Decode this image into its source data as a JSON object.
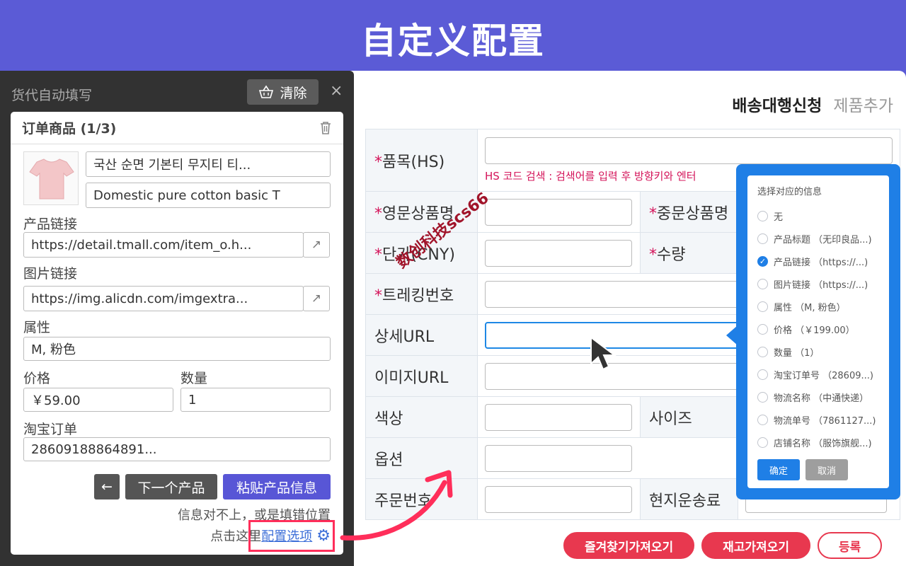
{
  "banner": {
    "title": "自定义配置"
  },
  "page": {
    "tabs": [
      {
        "label": "배송대행신청",
        "active": true
      },
      {
        "label": "제품추가",
        "active": false
      }
    ],
    "fields": {
      "hs_label": "품목(HS)",
      "hs_hint": "HS 코드 검색 : 검색어를 입력 후 방향키와 엔터",
      "eng_name": "영문상품명",
      "cn_name": "중문상품명",
      "price": "단가(CNY)",
      "qty": "수량",
      "tracking": "트레킹번호",
      "detail_url": "상세URL",
      "image_url": "이미지URL",
      "color": "색상",
      "size": "사이즈",
      "option": "옵션",
      "order_no": "주문번호",
      "local_shipping": "현지운송료"
    },
    "required_mark": "*",
    "buttons": {
      "favorites": "즐겨찾기가져오기",
      "stock": "재고가져오기",
      "register": "등록"
    }
  },
  "dropdown": {
    "title": "选择对应的信息",
    "options": [
      {
        "label": "无",
        "checked": false
      },
      {
        "label": "产品标题 （无印良品...)",
        "checked": false
      },
      {
        "label": "产品链接 （https://...)",
        "checked": true
      },
      {
        "label": "图片链接 （https://...)",
        "checked": false
      },
      {
        "label": "属性 （M, 粉色）",
        "checked": false
      },
      {
        "label": "价格 （￥199.00）",
        "checked": false
      },
      {
        "label": "数量 （1）",
        "checked": false
      },
      {
        "label": "淘宝订单号 （28609...)",
        "checked": false
      },
      {
        "label": "物流名称 （中通快递）",
        "checked": false
      },
      {
        "label": "物流单号 （7861127...)",
        "checked": false
      },
      {
        "label": "店铺名称 （服饰旗舰...)",
        "checked": false
      }
    ],
    "ok": "确定",
    "cancel": "取消"
  },
  "panel": {
    "title": "货代自动填写",
    "clear": "清除",
    "close": "×",
    "card_title": "订单商品 (1/3)",
    "product_title_ko": "국산 순면 기본티 무지티 티...",
    "product_title_en": "Domestic pure cotton basic T",
    "link_label": "产品链接",
    "link_value": "https://detail.tmall.com/item_o.h...",
    "img_label": "图片链接",
    "img_value": "https://img.alicdn.com/imgextra...",
    "attr_label": "属性",
    "attr_value": "M, 粉色",
    "price_label": "价格",
    "price_value": "￥59.00",
    "qty_label": "数量",
    "qty_value": "1",
    "order_label": "淘宝订单",
    "order_value": "28609188864891...",
    "back": "←",
    "next": "下一个产品",
    "paste": "粘贴产品信息",
    "hint_line1": "信息对不上，或是填错位置",
    "hint_line2": "点击这里",
    "config_link": "配置选项"
  },
  "watermark": "数创科技scs66",
  "colors": {
    "banner": "#5b5bd6",
    "accent_red": "#e8384f",
    "dropdown_blue": "#1f7fe6",
    "highlight": "#ff2e5a"
  }
}
